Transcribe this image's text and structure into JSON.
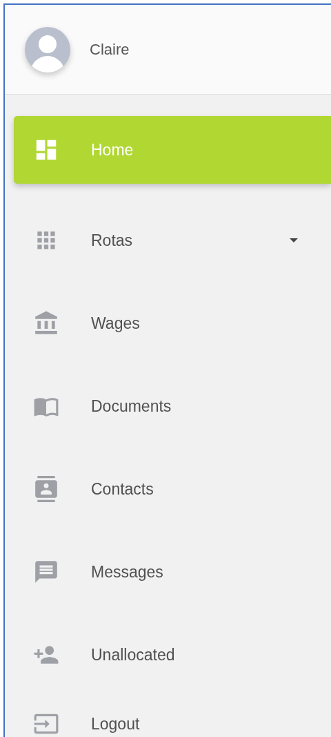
{
  "user": {
    "name": "Claire"
  },
  "menu": [
    {
      "label": "Home",
      "selected": true,
      "has_submenu": false
    },
    {
      "label": "Rotas",
      "selected": false,
      "has_submenu": true
    },
    {
      "label": "Wages",
      "selected": false,
      "has_submenu": false
    },
    {
      "label": "Documents",
      "selected": false,
      "has_submenu": false
    },
    {
      "label": "Contacts",
      "selected": false,
      "has_submenu": false
    },
    {
      "label": "Messages",
      "selected": false,
      "has_submenu": false
    },
    {
      "label": "Unallocated",
      "selected": false,
      "has_submenu": false
    },
    {
      "label": "Logout",
      "selected": false,
      "has_submenu": false
    }
  ]
}
